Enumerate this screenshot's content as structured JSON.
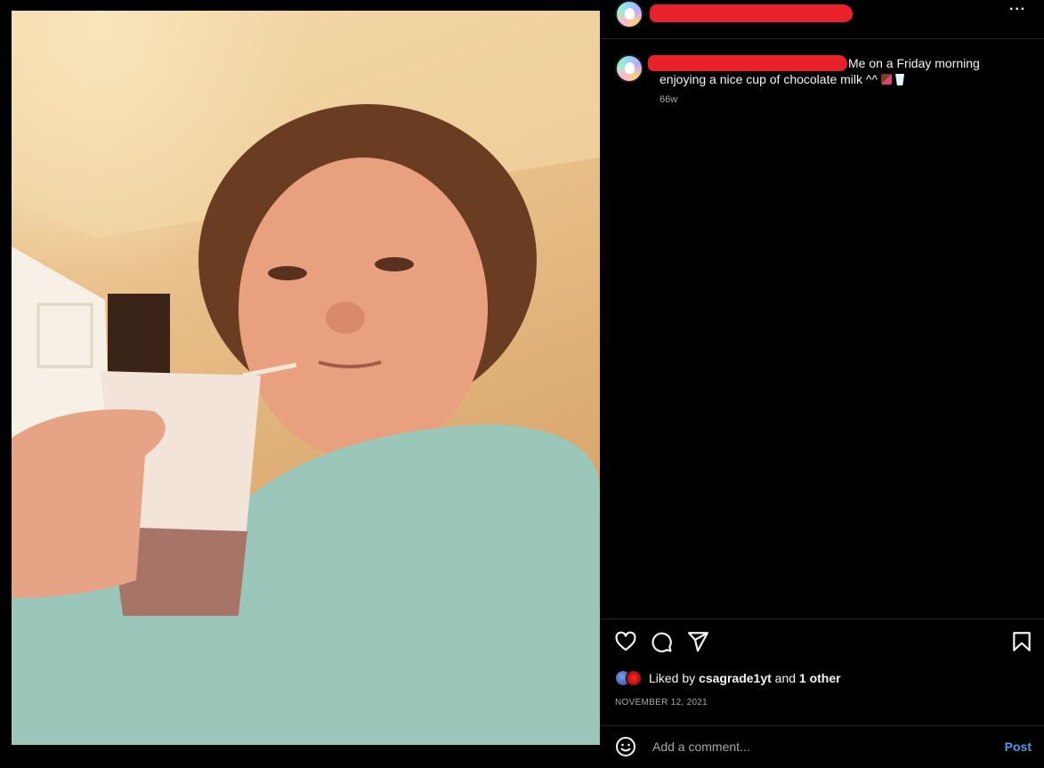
{
  "post": {
    "caption_text": "Me on a Friday morning enjoying a nice cup of chocolate milk ^^",
    "caption_emojis": [
      "chocolate-bar-emoji",
      "cup-with-straw-emoji"
    ],
    "time_ago": "66w",
    "likes": {
      "prefix": "Liked by",
      "username": "csagrade1yt",
      "and": "and",
      "others": "1 other"
    },
    "date": "NOVEMBER 12, 2021"
  },
  "header": {
    "more_icon": "more-options-icon",
    "more_label": "···"
  },
  "actions": {
    "icons": [
      "heart-icon",
      "comment-icon",
      "share-icon",
      "bookmark-icon"
    ]
  },
  "comment": {
    "placeholder": "Add a comment...",
    "post_label": "Post",
    "emoji_icon": "emoji-icon"
  },
  "colors": {
    "background": "#000000",
    "text": "#f5f5f5",
    "muted": "#a8a8a8",
    "link": "#4a9ee8",
    "redaction": "#e8212b"
  }
}
